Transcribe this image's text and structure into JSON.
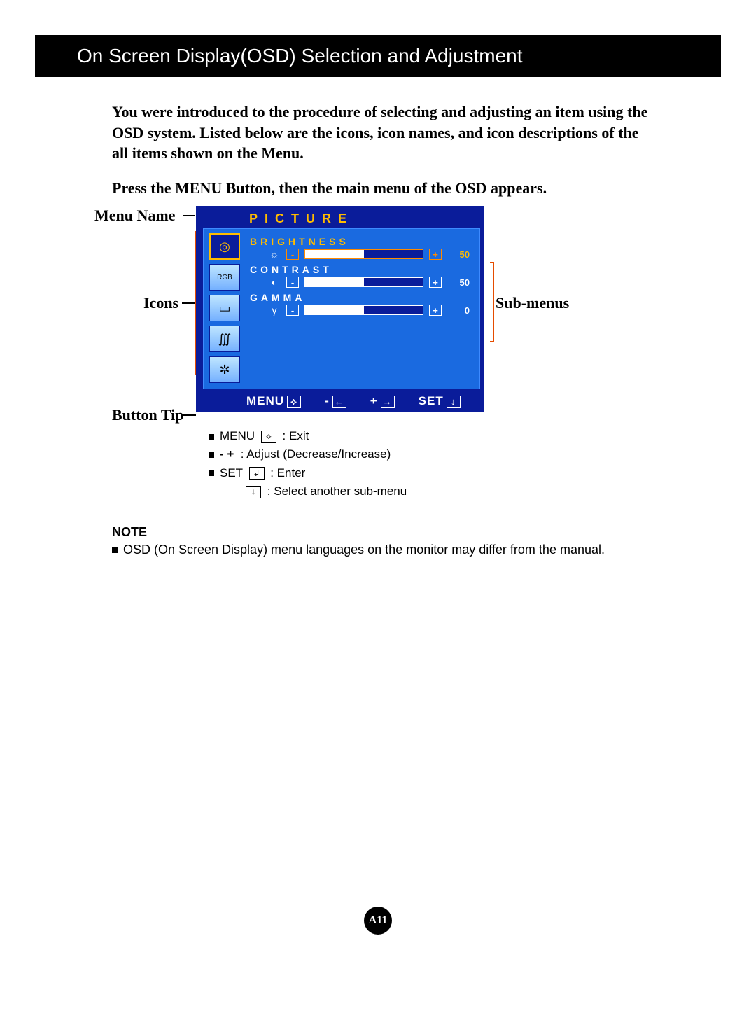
{
  "band_title": "On Screen Display(OSD) Selection and Adjustment",
  "intro": "You were introduced to the procedure of selecting and adjusting an item using the OSD system.  Listed below are the icons, icon names, and icon descriptions of the all items shown on the Menu.",
  "intro2": "Press the MENU Button, then the main menu of the OSD appears.",
  "annotations": {
    "menu_name": "Menu Name",
    "icons": "Icons",
    "button_tip": "Button Tip",
    "sub_menus": "Sub-menus"
  },
  "osd": {
    "title": "PICTURE",
    "icons": [
      {
        "name": "picture-icon",
        "glyph": "◎"
      },
      {
        "name": "color-icon",
        "glyph": "RGB"
      },
      {
        "name": "screen-icon",
        "glyph": "▭"
      },
      {
        "name": "tracking-icon",
        "glyph": "∭"
      },
      {
        "name": "setup-icon",
        "glyph": "✲"
      }
    ],
    "items": [
      {
        "label": "BRIGHTNESS",
        "glyph": "☼",
        "value": 50,
        "percent": 50,
        "selected": true
      },
      {
        "label": "CONTRAST",
        "glyph": "◐",
        "value": 50,
        "percent": 50,
        "selected": false
      },
      {
        "label": "GAMMA",
        "glyph": "γ",
        "value": 0,
        "percent": 50,
        "selected": false
      }
    ],
    "footer": {
      "menu": "MENU",
      "menu_glyph": "⟡",
      "minus": "-",
      "minus_glyph": "←",
      "plus": "+",
      "plus_glyph": "→",
      "set": "SET",
      "set_glyph": "↓"
    }
  },
  "legend": {
    "l1a": "MENU",
    "l1b": ": Exit",
    "l2": ": Adjust (Decrease/Increase)",
    "l2pre": "-   +",
    "l3a": "SET",
    "l3b": ": Enter",
    "l4": ": Select another sub-menu"
  },
  "note_head": "NOTE",
  "note_body": "OSD (On Screen Display) menu languages on the monitor may differ from the manual.",
  "page_num": "A11"
}
